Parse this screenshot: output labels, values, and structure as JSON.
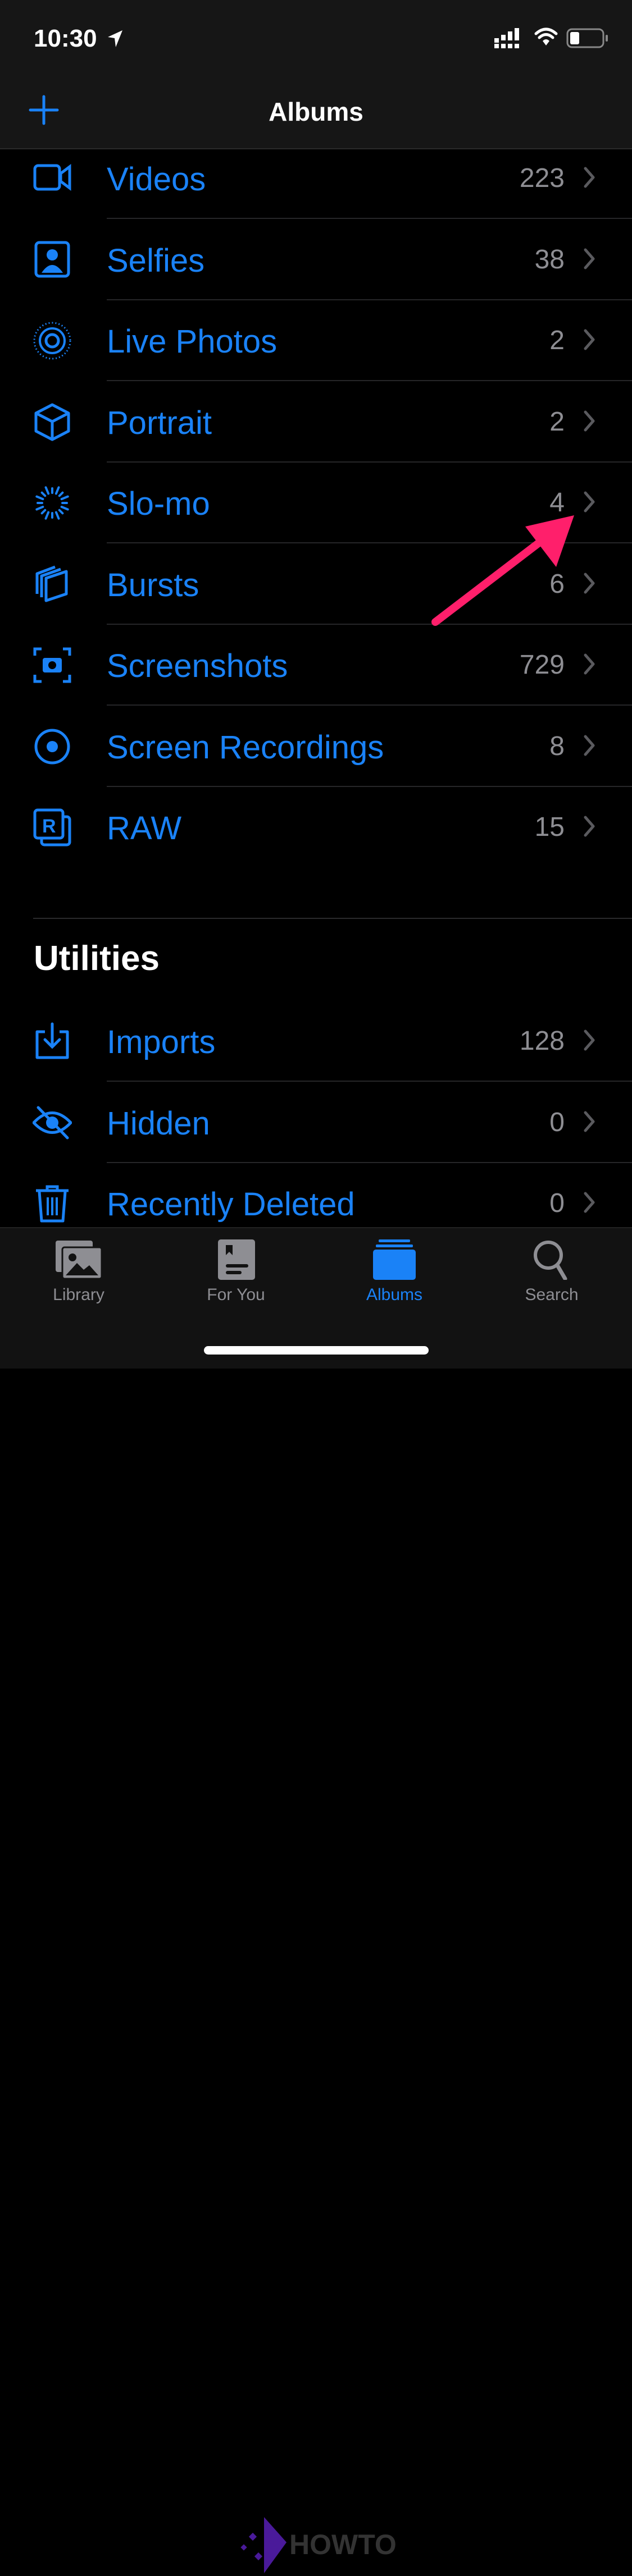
{
  "status_bar": {
    "time": "10:30",
    "icons": [
      "location-arrow-icon",
      "cellular-signal-icon",
      "wifi-icon",
      "battery-icon"
    ],
    "battery_level": 0.25
  },
  "header": {
    "title": "Albums",
    "add_icon": "plus-icon"
  },
  "media_types": [
    {
      "label": "Videos",
      "count": "223",
      "icon": "video"
    },
    {
      "label": "Selfies",
      "count": "38",
      "icon": "selfie"
    },
    {
      "label": "Live Photos",
      "count": "2",
      "icon": "live"
    },
    {
      "label": "Portrait",
      "count": "2",
      "icon": "cube"
    },
    {
      "label": "Slo-mo",
      "count": "4",
      "icon": "slomo"
    },
    {
      "label": "Bursts",
      "count": "6",
      "icon": "bursts"
    },
    {
      "label": "Screenshots",
      "count": "729",
      "icon": "screenshot"
    },
    {
      "label": "Screen Recordings",
      "count": "8",
      "icon": "record"
    },
    {
      "label": "RAW",
      "count": "15",
      "icon": "raw"
    }
  ],
  "utilities": {
    "heading": "Utilities",
    "items": [
      {
        "label": "Imports",
        "count": "128",
        "icon": "import"
      },
      {
        "label": "Hidden",
        "count": "0",
        "icon": "hidden"
      },
      {
        "label": "Recently Deleted",
        "count": "0",
        "icon": "trash"
      }
    ]
  },
  "tabs": [
    {
      "label": "Library",
      "icon": "library-icon",
      "active": false
    },
    {
      "label": "For You",
      "icon": "for-you-icon",
      "active": false
    },
    {
      "label": "Albums",
      "icon": "albums-icon",
      "active": true
    },
    {
      "label": "Search",
      "icon": "search-icon",
      "active": false
    }
  ],
  "watermark": "HOWTO",
  "colors": {
    "accent": "#1a82f7",
    "annotation_arrow": "#ff1f6b",
    "background": "#000000"
  }
}
